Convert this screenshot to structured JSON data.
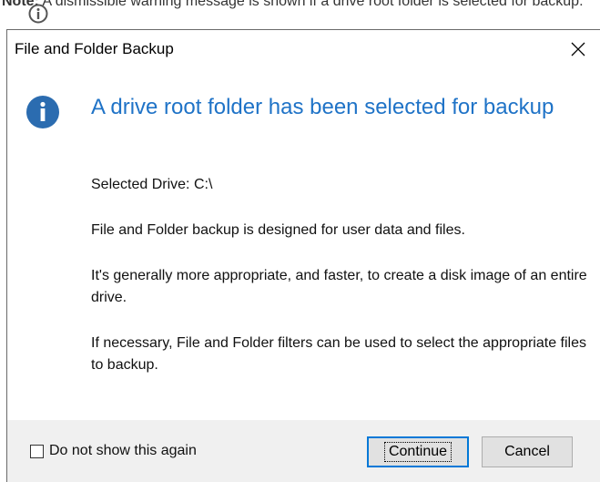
{
  "note": {
    "bold": "Note:",
    "text": " A dismissible warning message is shown if a drive root folder is selected for backup."
  },
  "dialog": {
    "title": "File and Folder Backup",
    "heading": "A drive root folder has been selected for backup",
    "selected_drive": "Selected Drive: C:\\",
    "para1": "File and Folder backup is designed for user data and files.",
    "para2": "It's generally more appropriate, and faster, to create a disk image of an entire drive.",
    "para3": "If necessary, File and Folder filters can be used to select the appropriate files to backup.",
    "checkbox_label": "Do not show this again",
    "checkbox_checked": false,
    "continue_label": "Continue",
    "cancel_label": "Cancel"
  },
  "colors": {
    "accent": "#1f73c7",
    "info_icon": "#2b6cb0",
    "footer_bg": "#f0f0f0",
    "primary_border": "#0078d7"
  },
  "icons": {
    "note": "info-circle-icon",
    "dialog": "info-icon",
    "close": "close-icon"
  }
}
